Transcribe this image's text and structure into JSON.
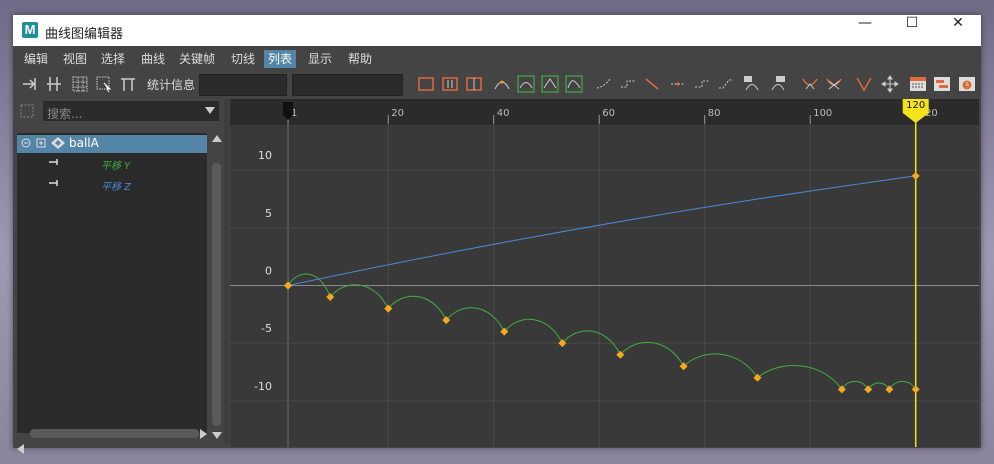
{
  "window": {
    "title": "曲线图编辑器",
    "app_icon_letter": "M",
    "minimize_glyph": "—",
    "maximize_glyph": "☐",
    "close_glyph": "✕"
  },
  "menu": {
    "items": [
      "编辑",
      "视图",
      "选择",
      "曲线",
      "关键帧",
      "切线",
      "列表",
      "显示",
      "帮助"
    ],
    "active": "列表"
  },
  "toolbar": {
    "stats_label": "统计信息",
    "stats_value_1": "",
    "stats_value_2": ""
  },
  "outliner": {
    "search_placeholder": "搜索...",
    "node": "ballA",
    "attributes": [
      {
        "label": "平移 Y",
        "color": "#3fae3f"
      },
      {
        "label": "平移 Z",
        "color": "#4a89d8"
      }
    ]
  },
  "colors": {
    "accent": "#5285a6",
    "key": "#f4a81d",
    "current_time": "#f5e21a",
    "curve_y": "#3fae3f",
    "curve_z": "#4a89d8"
  },
  "graph": {
    "current_frame_label": "120",
    "chart_data": {
      "type": "line",
      "x_ticks": [
        1,
        20,
        40,
        60,
        80,
        100,
        120
      ],
      "y_ticks": [
        10,
        5,
        0,
        -5,
        -10
      ],
      "xlim": [
        -10,
        132
      ],
      "ylim": [
        -14,
        14
      ],
      "current_frame": 120,
      "series": [
        {
          "name": "平移 Y",
          "color": "#3fae3f",
          "keys": [
            [
              1,
              0
            ],
            [
              9,
              -1
            ],
            [
              20,
              -2
            ],
            [
              31,
              -3
            ],
            [
              42,
              -4
            ],
            [
              53,
              -5
            ],
            [
              64,
              -6
            ],
            [
              76,
              -7
            ],
            [
              90,
              -8
            ],
            [
              106,
              -9
            ],
            [
              111,
              -9
            ],
            [
              115,
              -9
            ],
            [
              120,
              -9
            ]
          ]
        },
        {
          "name": "平移 Z",
          "color": "#4a89d8",
          "keys": [
            [
              1,
              0
            ],
            [
              120,
              9.5
            ]
          ]
        }
      ]
    }
  }
}
